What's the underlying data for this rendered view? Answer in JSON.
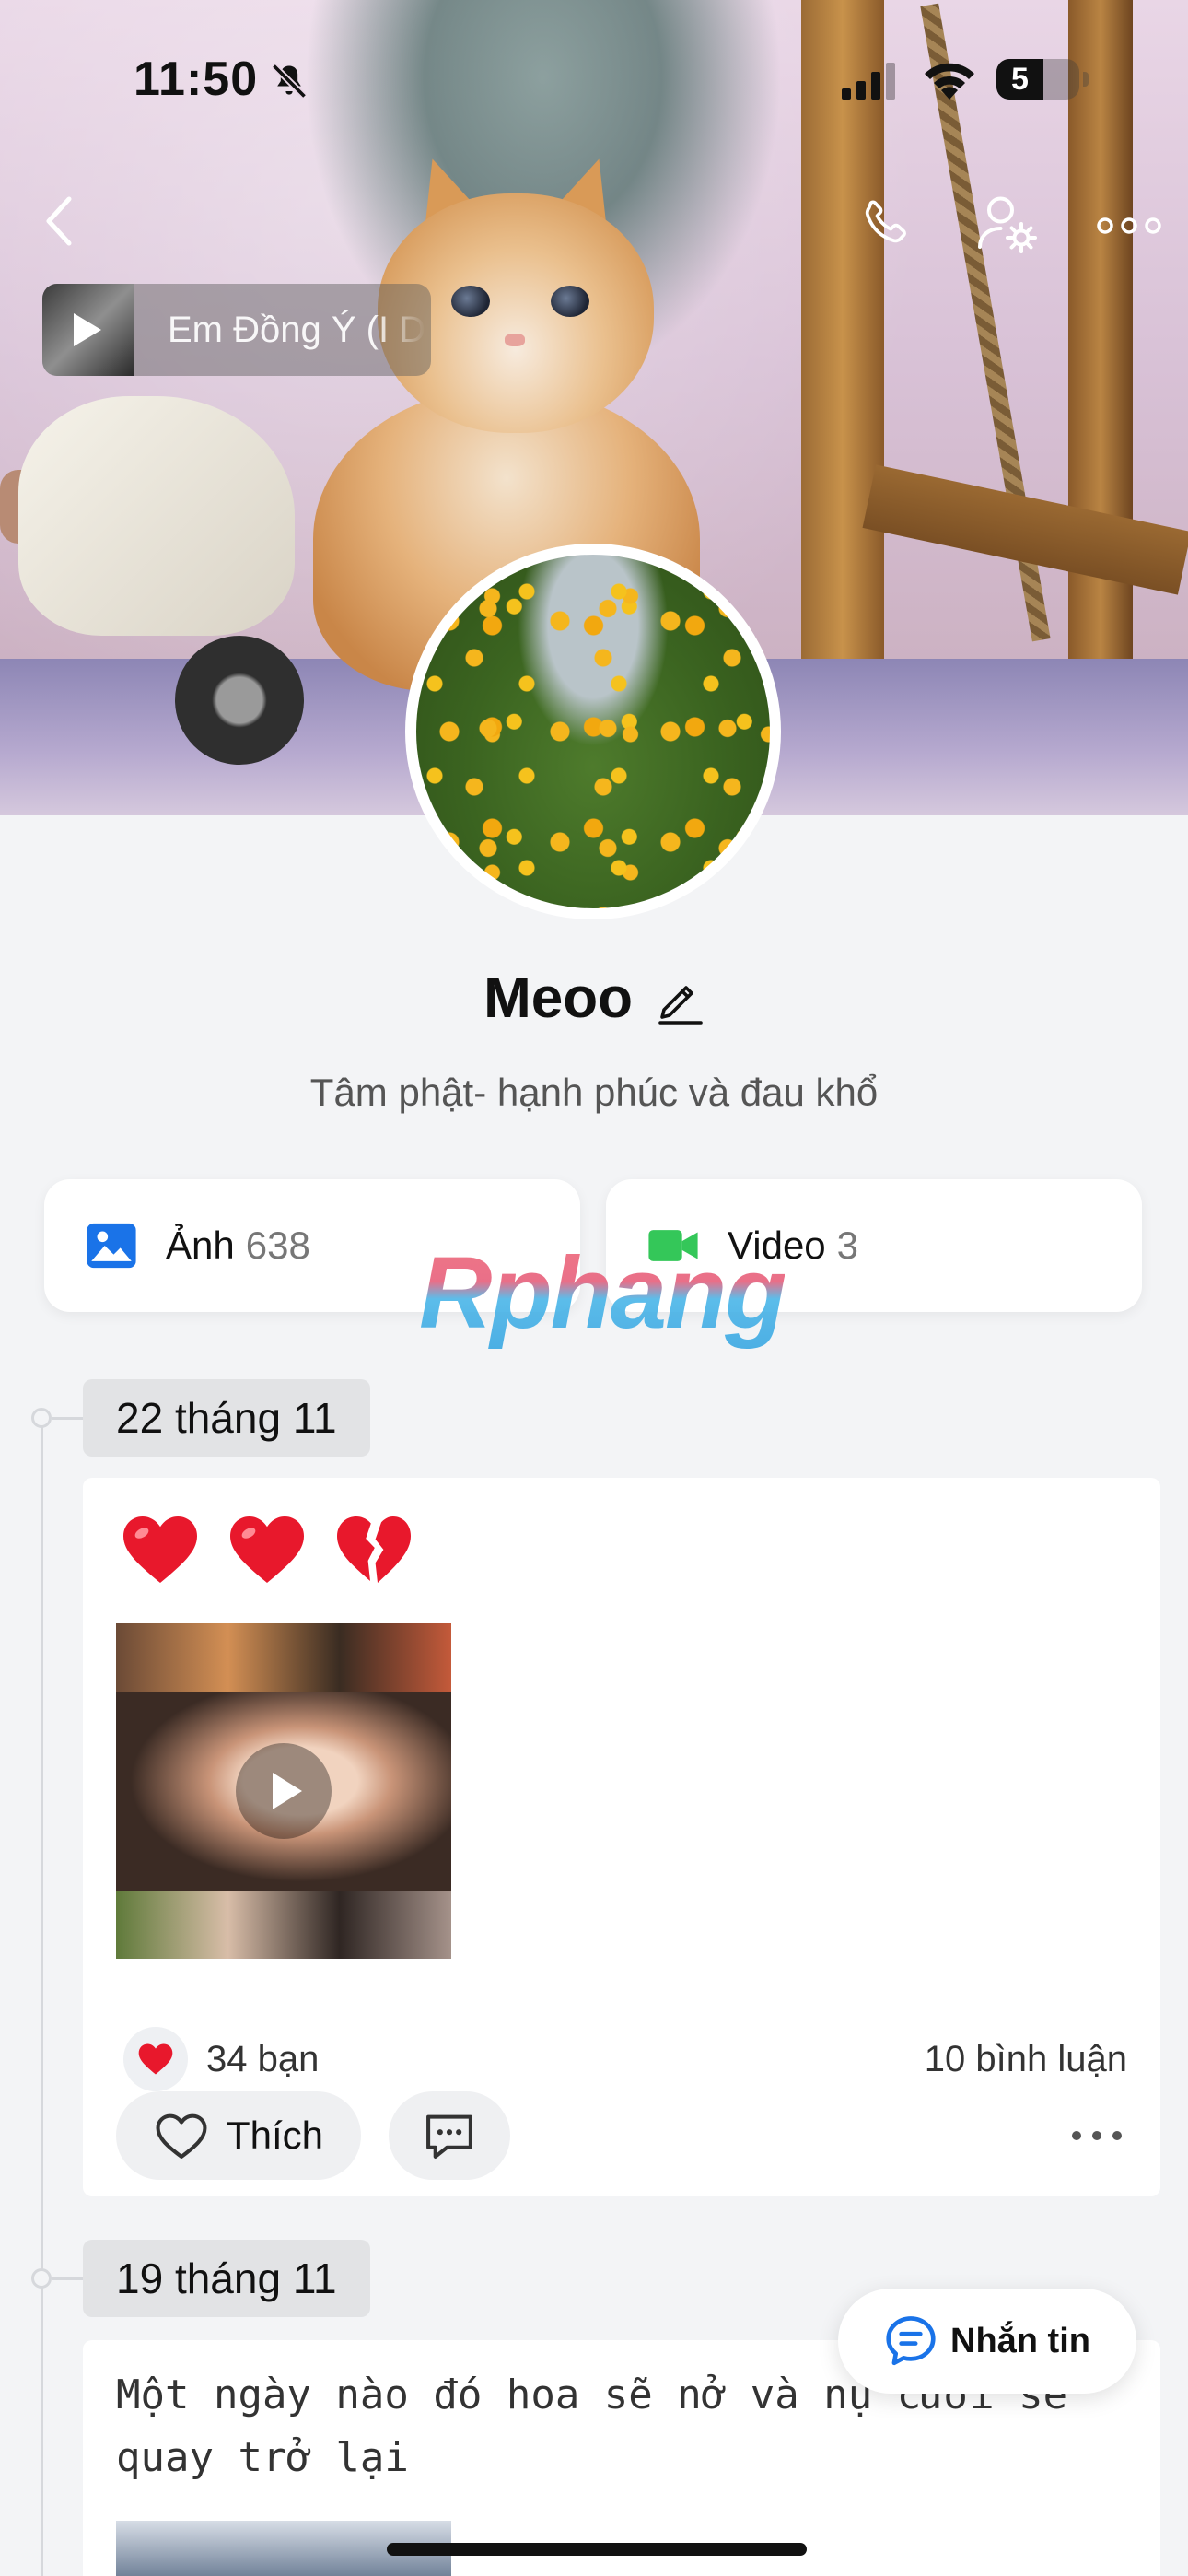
{
  "status_bar": {
    "time": "11:50",
    "battery_level": "57",
    "battery_display": "5"
  },
  "music": {
    "title": "Em Đồng Ý (I D"
  },
  "profile": {
    "name": "Meoo",
    "bio": "Tâm phật- hạnh phúc và đau khổ"
  },
  "media": {
    "photos_label": "Ảnh",
    "photos_count": "638",
    "videos_label": "Video",
    "videos_count": "3"
  },
  "watermark": "Rphang",
  "posts": [
    {
      "date": "22 tháng 11",
      "emojis": [
        "red-heart",
        "red-heart",
        "broken-heart"
      ],
      "likes": "34 bạn",
      "comments": "10 bình luận",
      "like_label": "Thích"
    },
    {
      "date": "19 tháng 11",
      "text": "Một ngày nào đó hoa sẽ nở và nụ cười sẽ quay trở lại"
    }
  ],
  "fab": {
    "label": "Nhắn tin"
  },
  "colors": {
    "accent_blue": "#1a73e8",
    "video_green": "#34c759",
    "heart_red": "#e8182c",
    "background": "#f3f4f6"
  }
}
